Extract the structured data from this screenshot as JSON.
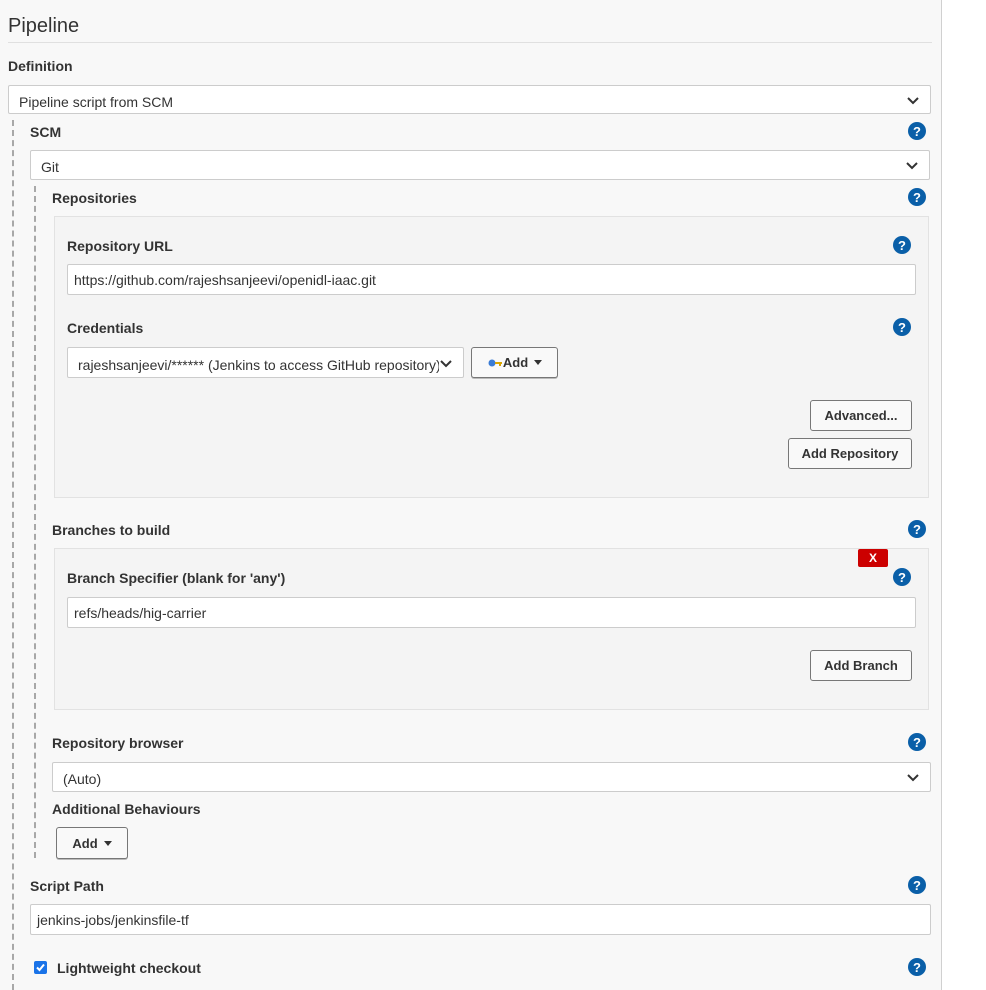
{
  "section": {
    "title": "Pipeline"
  },
  "definition": {
    "label": "Definition",
    "selected": "Pipeline script from SCM"
  },
  "scm": {
    "label": "SCM",
    "selected": "Git"
  },
  "repositories": {
    "label": "Repositories",
    "repository_url": {
      "label": "Repository URL",
      "value": "https://github.com/rajeshsanjeevi/openidl-iaac.git"
    },
    "credentials": {
      "label": "Credentials",
      "selected": "rajeshsanjeevi/****** (Jenkins to access GitHub repository)",
      "add_label": "Add"
    },
    "advanced_label": "Advanced...",
    "add_repository_label": "Add Repository"
  },
  "branches": {
    "label": "Branches to build",
    "delete_label": "X",
    "specifier": {
      "label": "Branch Specifier (blank for 'any')",
      "value": "refs/heads/hig-carrier"
    },
    "add_branch_label": "Add Branch"
  },
  "repository_browser": {
    "label": "Repository browser",
    "selected": "(Auto)"
  },
  "additional_behaviours": {
    "label": "Additional Behaviours",
    "add_label": "Add"
  },
  "script_path": {
    "label": "Script Path",
    "value": "jenkins-jobs/jenkinsfile-tf"
  },
  "lightweight_checkout": {
    "label": "Lightweight checkout",
    "checked": true
  },
  "help_symbol": "?",
  "colors": {
    "help": "#0a5fa8",
    "delete": "#cc0000",
    "checkbox": "#1a73e8"
  }
}
